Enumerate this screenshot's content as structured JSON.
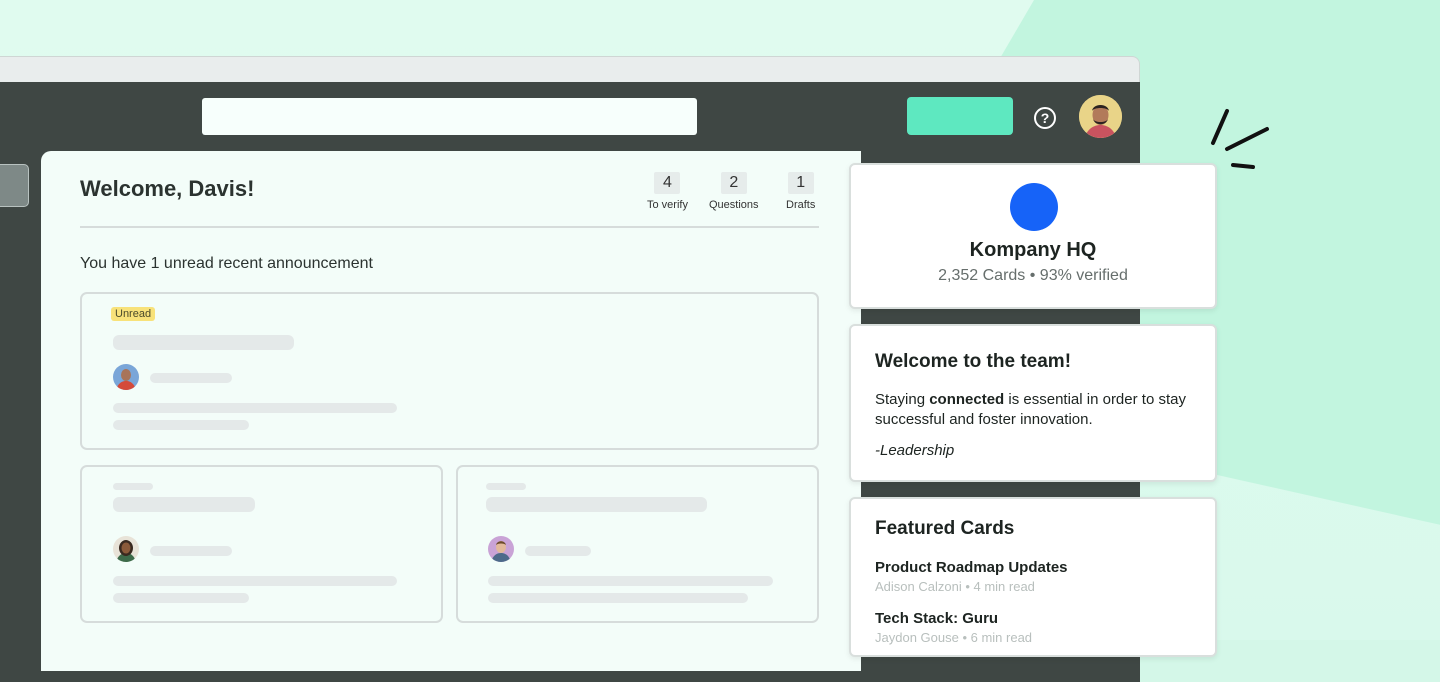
{
  "topbar": {
    "search_placeholder": "",
    "new_button_label": "",
    "help_icon": "?"
  },
  "header": {
    "welcome": "Welcome, Davis!",
    "stats": [
      {
        "value": "4",
        "label": "To verify"
      },
      {
        "value": "2",
        "label": "Questions"
      },
      {
        "value": "1",
        "label": "Drafts"
      }
    ]
  },
  "announcements": {
    "summary": "You have 1 unread recent announcement",
    "badge": "Unread"
  },
  "company": {
    "name": "Kompany HQ",
    "stats": "2,352 Cards • 93% verified",
    "color": "#1663f8"
  },
  "team_note": {
    "title": "Welcome to the team!",
    "body_prefix": "Staying ",
    "body_bold": "connected",
    "body_suffix": " is essential in order to stay successful and foster innovation.",
    "signature": "-Leadership"
  },
  "featured": {
    "title": "Featured Cards",
    "items": [
      {
        "title": "Product Roadmap Updates",
        "meta": "Adison Calzoni • 4 min read"
      },
      {
        "title": "Tech Stack: Guru",
        "meta": "Jaydon Gouse • 6 min read"
      }
    ]
  },
  "colors": {
    "accent": "#5ee8c0",
    "topbar": "#3f4744",
    "badge": "#f8e27a"
  }
}
